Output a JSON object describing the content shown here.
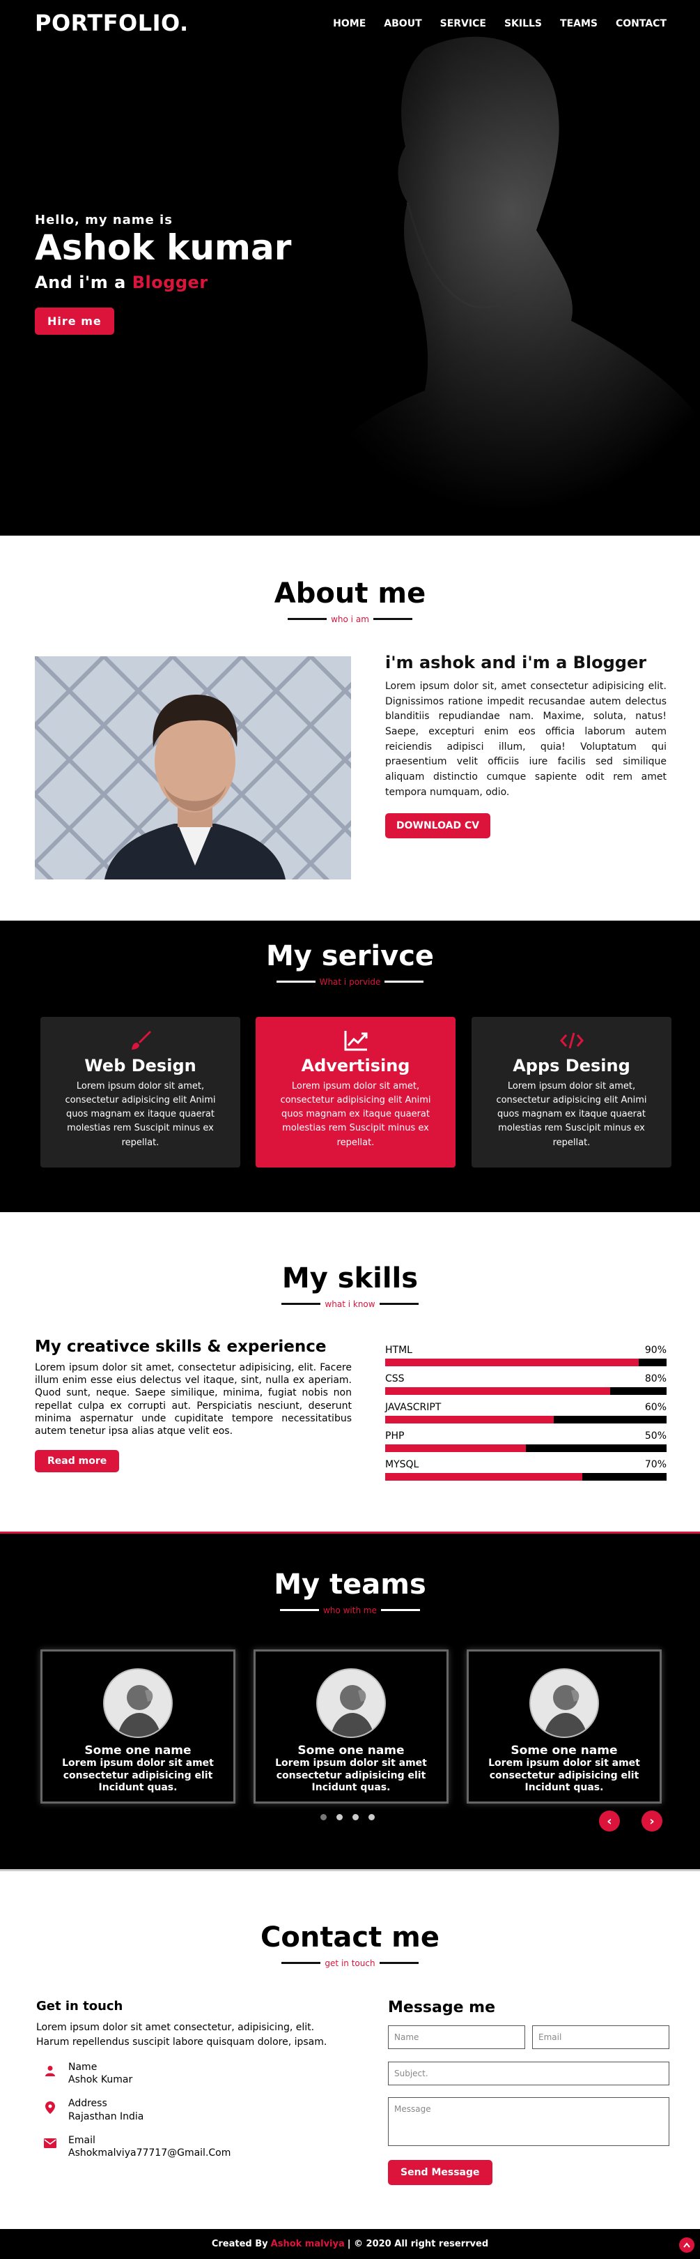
{
  "nav": {
    "logo": "PORTFOLIO.",
    "items": [
      "HOME",
      "ABOUT",
      "SERVICE",
      "SKILLS",
      "TEAMS",
      "CONTACT"
    ]
  },
  "hero": {
    "hello": "Hello, my name is",
    "name": "Ashok kumar",
    "role_prefix": "And i'm a",
    "role_accent": "Blogger",
    "button": "Hire me"
  },
  "about": {
    "title": "About me",
    "subtitle": "who i am",
    "heading": "i'm ashok and i'm a Blogger",
    "body": "Lorem ipsum dolor sit, amet consectetur adipisicing elit. Dignissimos ratione impedit recusandae autem delectus blanditiis repudiandae nam. Maxime, soluta, natus! Saepe, excepturi enim eos officia laborum autem reiciendis adipisci illum, quia! Voluptatum qui praesentium velit officiis iure facilis sed similique aliquam distinctio cumque sapiente odit rem amet tempora numquam, odio.",
    "button": "DOWNLOAD CV"
  },
  "services": {
    "title": "My serivce",
    "subtitle": "What i porvide",
    "items": [
      {
        "title": "Web Design",
        "icon": "paintbrush-icon",
        "text": "Lorem ipsum dolor sit amet, consectetur adipisicing elit Animi quos magnam ex itaque quaerat molestias rem Suscipit minus ex repellat."
      },
      {
        "title": "Advertising",
        "icon": "chart-line-icon",
        "text": "Lorem ipsum dolor sit amet, consectetur adipisicing elit Animi quos magnam ex itaque quaerat molestias rem Suscipit minus ex repellat."
      },
      {
        "title": "Apps Desing",
        "icon": "code-icon",
        "text": "Lorem ipsum dolor sit amet, consectetur adipisicing elit Animi quos magnam ex itaque quaerat molestias rem Suscipit minus ex repellat."
      }
    ]
  },
  "skills": {
    "title": "My skills",
    "subtitle": "what i know",
    "heading": "My creativce skills & experience",
    "body": "Lorem ipsum dolor sit amet, consectetur adipisicing, elit. Facere illum enim esse eius delectus vel itaque, sint, nulla ex aperiam. Quod sunt, neque. Saepe similique, minima, fugiat nobis non repellat culpa ex corrupti aut. Perspiciatis nesciunt, deserunt minima aspernatur unde cupiditate tempore necessitatibus autem tenetur ipsa alias atque velit eos.",
    "button": "Read more",
    "list": [
      {
        "name": "HTML",
        "percent": "90%",
        "value": 90
      },
      {
        "name": "CSS",
        "percent": "80%",
        "value": 80
      },
      {
        "name": "JAVASCRIPT",
        "percent": "60%",
        "value": 60
      },
      {
        "name": "PHP",
        "percent": "50%",
        "value": 50
      },
      {
        "name": "MYSQL",
        "percent": "70%",
        "value": 70
      }
    ]
  },
  "teams": {
    "title": "My teams",
    "subtitle": "who with me",
    "members": [
      {
        "name": "Some one name",
        "text": "Lorem ipsum dolor sit amet consectetur adipisicing elit Incidunt quas."
      },
      {
        "name": "Some one name",
        "text": "Lorem ipsum dolor sit amet consectetur adipisicing elit Incidunt quas."
      },
      {
        "name": "Some one name",
        "text": "Lorem ipsum dolor sit amet consectetur adipisicing elit Incidunt quas."
      }
    ],
    "prev": "‹",
    "next": "›"
  },
  "contact": {
    "title": "Contact me",
    "subtitle": "get in touch",
    "left_heading": "Get in touch",
    "intro": "Lorem ipsum dolor sit amet consectetur, adipisicing, elit. Harum repellendus suscipit labore quisquam dolore, ipsam.",
    "info": [
      {
        "label": "Name",
        "value": "Ashok Kumar",
        "icon": "user-icon"
      },
      {
        "label": "Address",
        "value": "Rajasthan India",
        "icon": "map-marker-icon"
      },
      {
        "label": "Email",
        "value": "Ashokmalviya77717@Gmail.Com",
        "icon": "envelope-icon"
      }
    ],
    "form_heading": "Message me",
    "name_placeholder": "Name",
    "email_placeholder": "Email",
    "subject_placeholder": "Subject.",
    "message_placeholder": "Message",
    "button": "Send Message"
  },
  "footer": {
    "prefix": "Created By",
    "author": "Ashok malviya",
    "suffix": "| © 2020 All right reserrved"
  },
  "colors": {
    "accent": "#dc143c",
    "dark": "#000000",
    "card": "#222222"
  }
}
